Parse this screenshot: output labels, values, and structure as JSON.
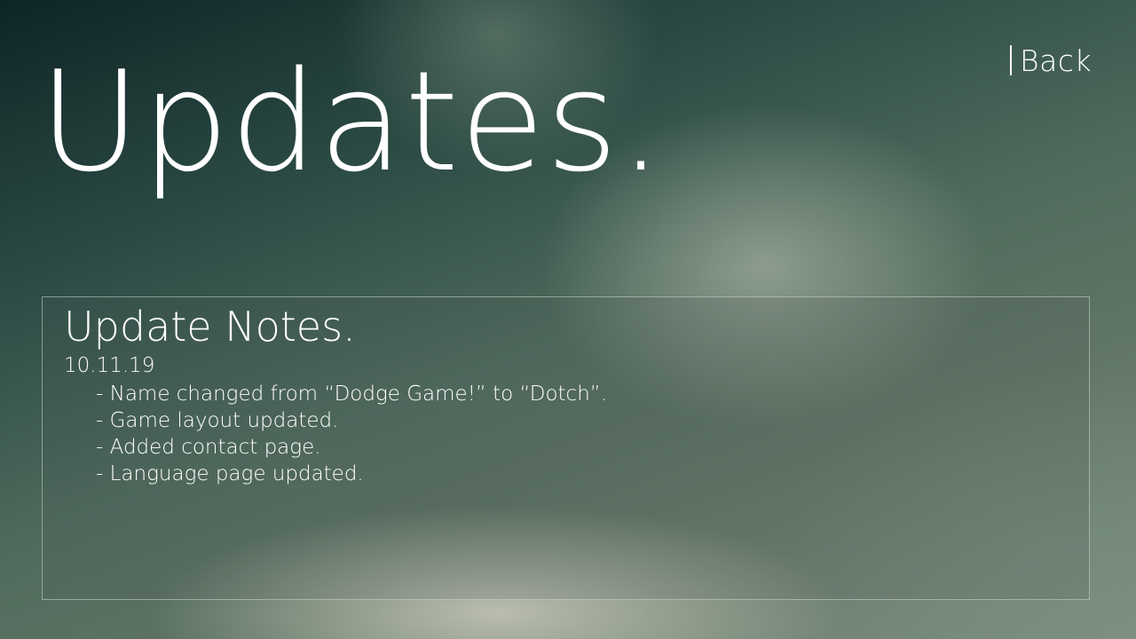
{
  "header": {
    "back_label": "Back",
    "title": "Updates."
  },
  "notes": {
    "title": "Update Notes.",
    "date": "10.11.19",
    "items": [
      "- Name changed from “Dodge Game!” to “Dotch”.",
      "- Game layout updated.",
      "- Added contact page.",
      "- Language page updated."
    ]
  }
}
